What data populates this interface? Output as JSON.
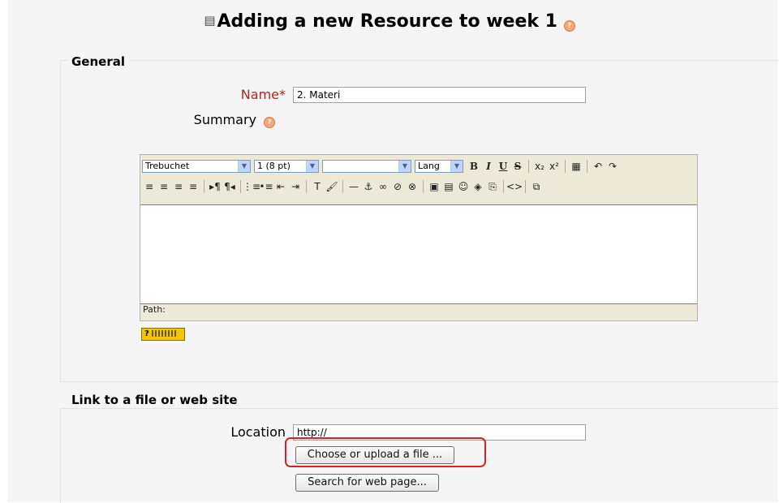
{
  "page": {
    "title": "Adding a new Resource to week 1",
    "help_glyph": "?"
  },
  "general": {
    "legend": "General",
    "name_label": "Name",
    "required_mark": "*",
    "name_value": "2. Materi",
    "summary_label": "Summary"
  },
  "editor": {
    "font_family": "Trebuchet",
    "font_size": "1 (8 pt)",
    "heading_format": "",
    "lang": "Lang",
    "toolbar_row1": [
      "B",
      "I",
      "U",
      "S",
      "x₂",
      "x²",
      "▦",
      "↶",
      "↷"
    ],
    "toolbar_row2": [
      "≡",
      "≡",
      "≡",
      "≡",
      "▸¶",
      "¶◂",
      "⋮≡",
      "•≡",
      "⇤",
      "⇥",
      "T",
      "🖌",
      "—",
      "⚓",
      "∞",
      "⊘",
      "⊗",
      "▣",
      "▤",
      "☺",
      "◈",
      "⎘",
      "<>",
      "⧉"
    ],
    "path_label": "Path:",
    "keyboard_help": "?"
  },
  "link": {
    "legend": "Link to a file or web site",
    "location_label": "Location",
    "location_value": "http://",
    "choose_button": "Choose or upload a file ...",
    "search_button": "Search for web page..."
  },
  "colors": {
    "required": "#b3261e",
    "highlight": "#e02020",
    "help_icon": "#f3a97a"
  }
}
